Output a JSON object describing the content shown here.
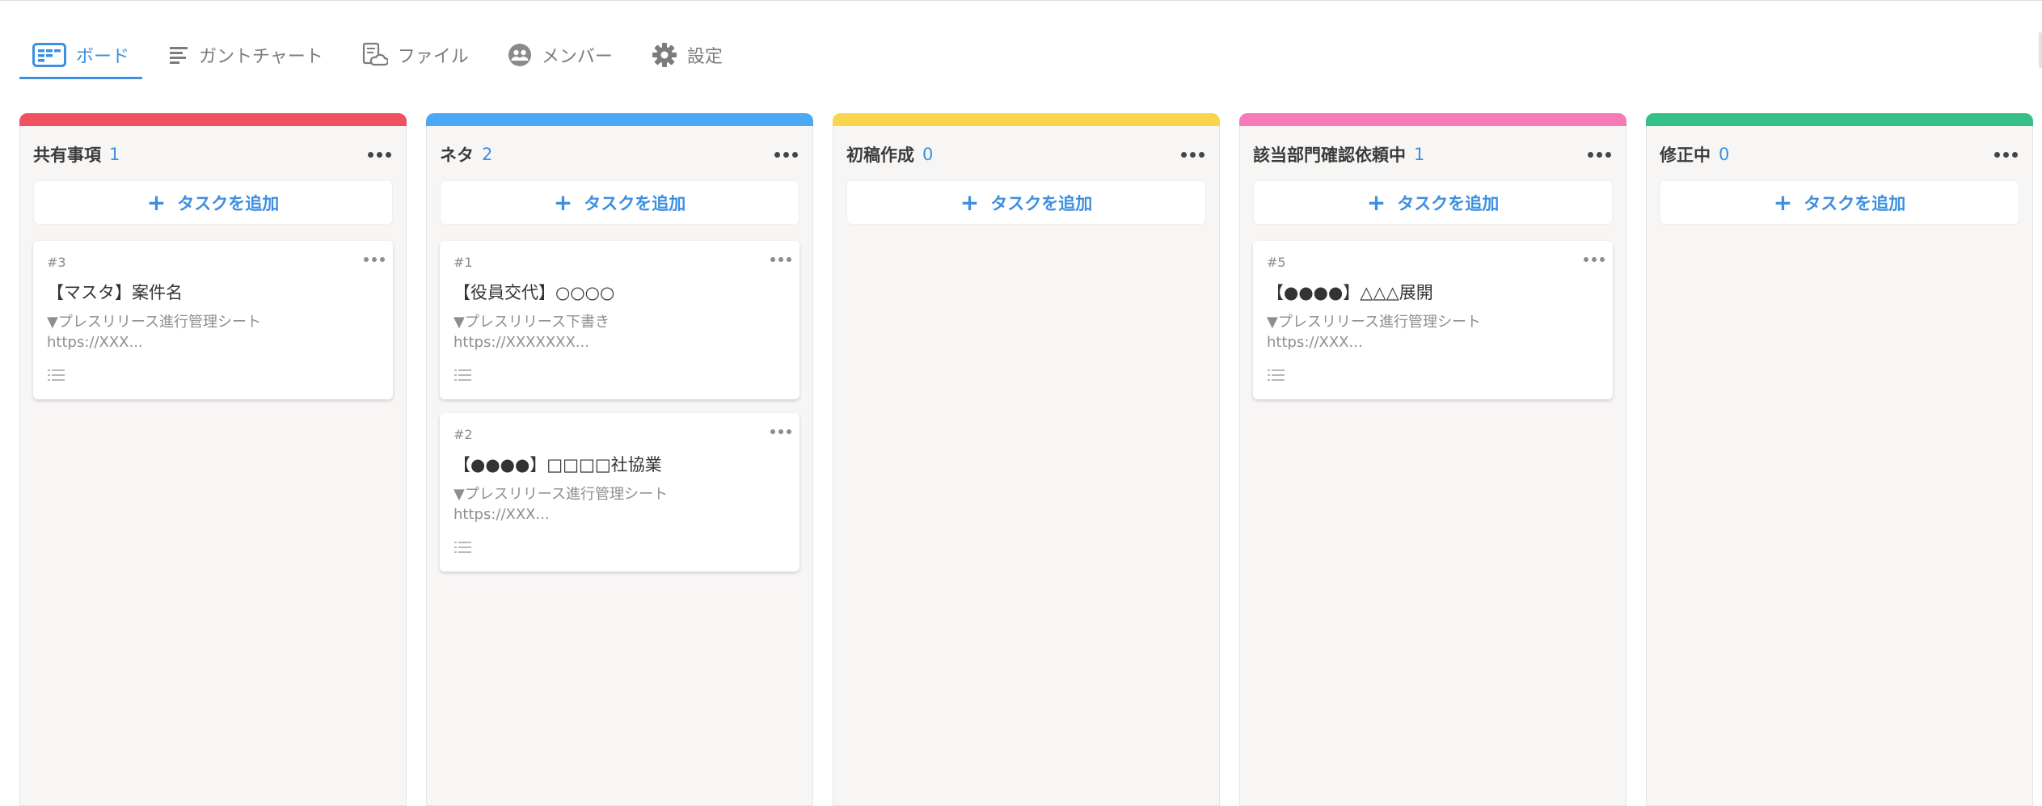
{
  "tabs": [
    {
      "label": "ボード",
      "icon": "board-icon",
      "active": true
    },
    {
      "label": "ガントチャート",
      "icon": "gantt-icon",
      "active": false
    },
    {
      "label": "ファイル",
      "icon": "file-cloud-icon",
      "active": false
    },
    {
      "label": "メンバー",
      "icon": "members-icon",
      "active": false
    },
    {
      "label": "設定",
      "icon": "gear-icon",
      "active": false
    }
  ],
  "add_task_label": "タスクを追加",
  "columns": [
    {
      "title": "共有事項",
      "count": "1",
      "color": "#ef5160",
      "cards": [
        {
          "id": "#3",
          "title": "【マスタ】案件名",
          "desc1": "▼プレスリリース進行管理シート",
          "desc2": "https://XXX..."
        }
      ]
    },
    {
      "title": "ネタ",
      "count": "2",
      "color": "#4aa8f5",
      "cards": [
        {
          "id": "#1",
          "title": "【役員交代】○○○○",
          "desc1": "▼プレスリリース下書き",
          "desc2": "https://XXXXXXX..."
        },
        {
          "id": "#2",
          "title": "【●●●●】□□□□社協業",
          "desc1": "▼プレスリリース進行管理シート",
          "desc2": "https://XXX..."
        }
      ]
    },
    {
      "title": "初稿作成",
      "count": "0",
      "color": "#f8d54c",
      "cards": []
    },
    {
      "title": "該当部門確認依頼中",
      "count": "1",
      "color": "#f67ab6",
      "cards": [
        {
          "id": "#5",
          "title": "【●●●●】△△△展開",
          "desc1": "▼プレスリリース進行管理シート",
          "desc2": "https://XXX..."
        }
      ]
    },
    {
      "title": "修正中",
      "count": "0",
      "color": "#35c08a",
      "cards": []
    }
  ]
}
